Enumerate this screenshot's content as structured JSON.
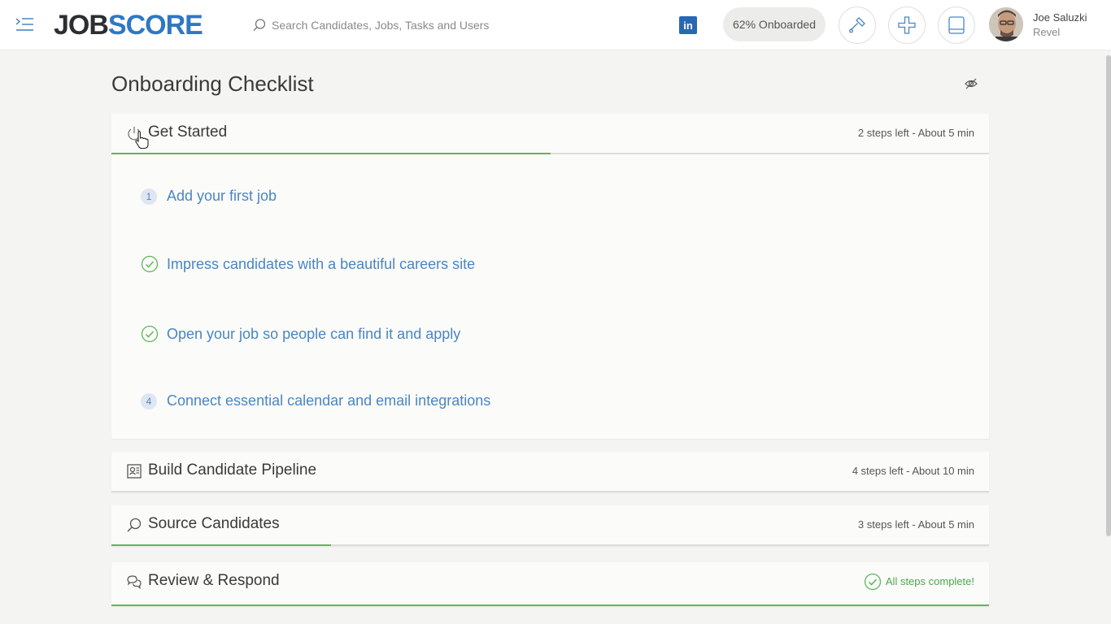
{
  "header": {
    "logo_part1": "JOB",
    "logo_part2": "SCORE",
    "search_placeholder": "Search Candidates, Jobs, Tasks and Users",
    "linkedin_label": "in",
    "onboarded_label": "62% Onboarded",
    "user_name": "Joe Saluzki",
    "user_org": "Revel",
    "icons": [
      "menu-icon",
      "search-icon",
      "linkedin-icon",
      "tools-icon",
      "add-icon",
      "tablet-icon"
    ]
  },
  "page": {
    "title": "Onboarding Checklist"
  },
  "sections": [
    {
      "title": "Get Started",
      "meta": "2 steps left - About 5 min",
      "progress_fraction": 0.5,
      "icon": "power-icon",
      "expanded": true,
      "steps": [
        {
          "marker": "1",
          "status": "pending",
          "label": "Add your first job"
        },
        {
          "marker": "",
          "status": "complete",
          "label": "Impress candidates with a beautiful careers site"
        },
        {
          "marker": "",
          "status": "complete",
          "label": "Open your job so people can find it and apply"
        },
        {
          "marker": "4",
          "status": "pending",
          "label": "Connect essential calendar and email integrations"
        }
      ]
    },
    {
      "title": "Build Candidate Pipeline",
      "meta": "4 steps left - About 10 min",
      "progress_fraction": 0,
      "icon": "profile-card-icon"
    },
    {
      "title": "Source Candidates",
      "meta": "3 steps left - About 5 min",
      "progress_fraction": 0.25,
      "icon": "search-icon"
    },
    {
      "title": "Review & Respond",
      "meta": "All steps complete!",
      "progress_fraction": 1,
      "icon": "chat-bubbles-icon"
    }
  ],
  "colors": {
    "accent_blue": "#2f77c2",
    "link_blue": "#4a86c5",
    "progress_green": "#5cb85c",
    "linkedin_blue": "#2867b2"
  }
}
